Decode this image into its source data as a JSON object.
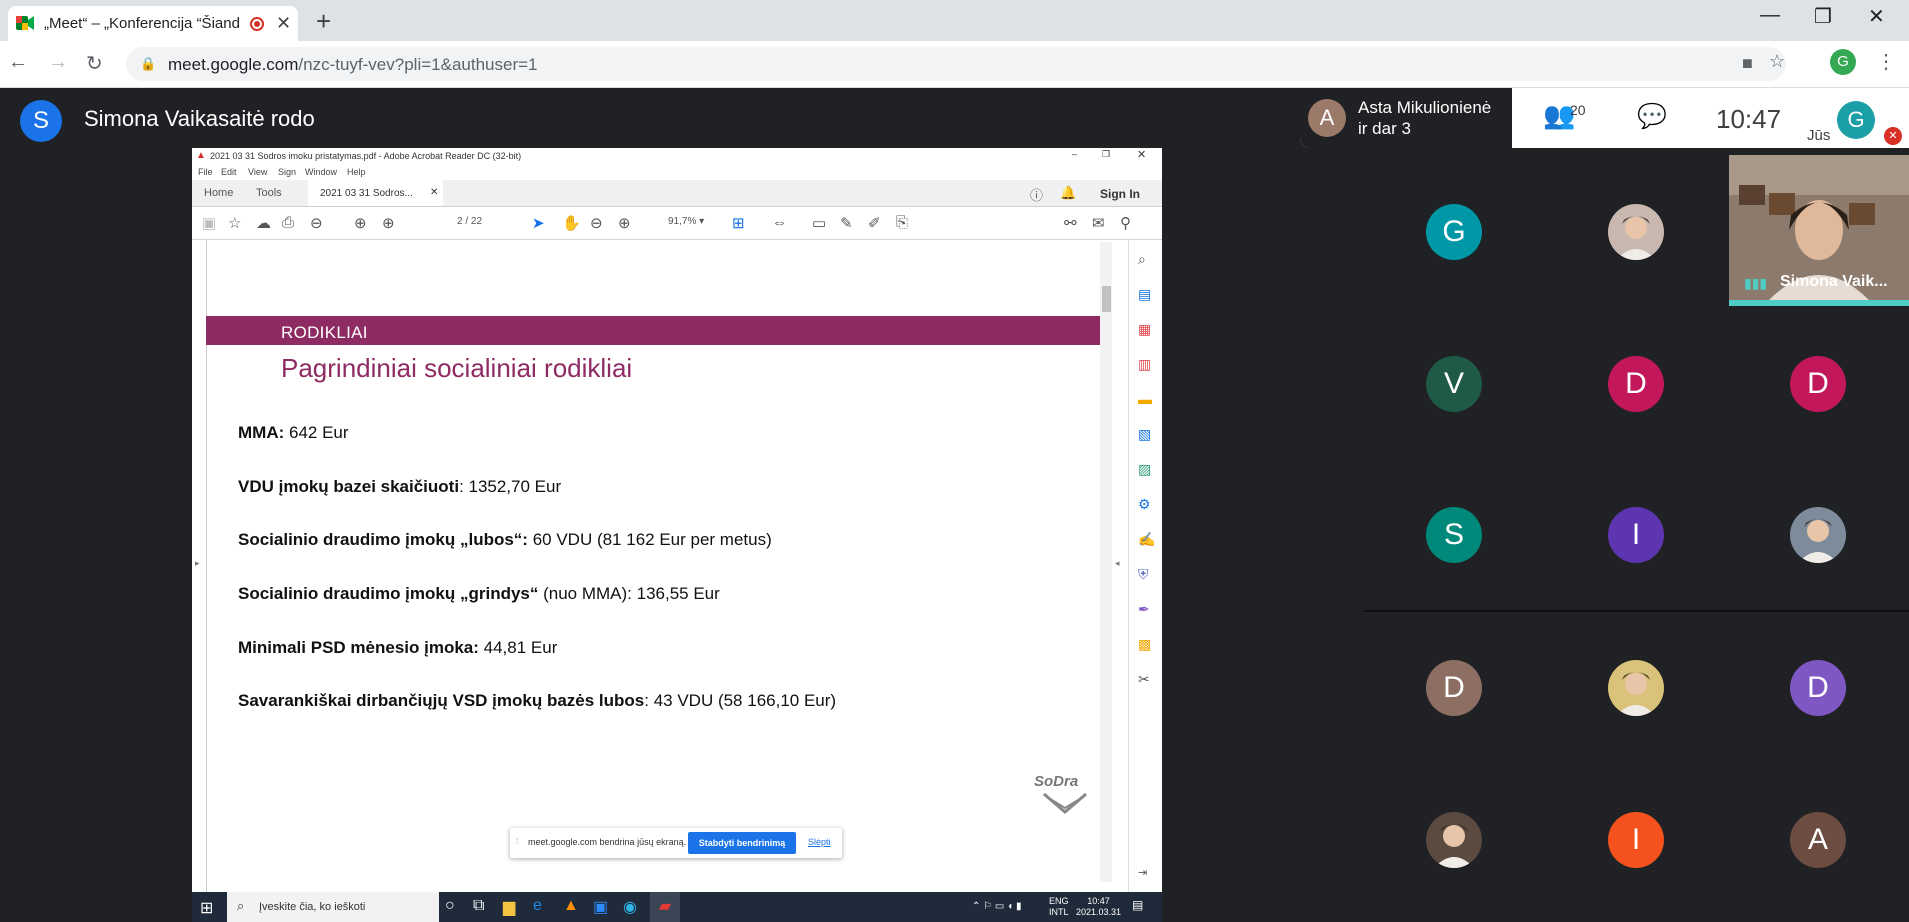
{
  "browser": {
    "tab_title": "„Meet“ – „Konferencija “Šiand",
    "url_host": "meet.google.com",
    "url_path": "/nzc-tuyf-vev?pli=1&authuser=1",
    "profile_letter": "G"
  },
  "meet": {
    "presenter_initial": "S",
    "presenter_label": "Simona Vaikasaitė rodo",
    "speaker_initial": "A",
    "speaker_name_line1": "Asta Mikulionienė",
    "speaker_name_line2": "ir dar 3",
    "participant_count": "20",
    "time": "10:47",
    "self_initial": "G",
    "self_label": "Jūs",
    "self_view_name": "Simona Vaik..."
  },
  "acrobat": {
    "window_title": "2021 03 31 Sodros  imoku pristatymas.pdf - Adobe Acrobat Reader DC (32-bit)",
    "menu": [
      "File",
      "Edit",
      "View",
      "Sign",
      "Window",
      "Help"
    ],
    "tab_home": "Home",
    "tab_tools": "Tools",
    "tab_doc": "2021 03 31 Sodros...",
    "sign_in": "Sign In",
    "page_current": "2",
    "page_total": "/ 22",
    "zoom": "91,7%"
  },
  "slide": {
    "banner": "RODIKLIAI",
    "title": "Pagrindiniai socialiniai rodikliai",
    "lines": [
      {
        "bold": "MMA:",
        "rest": " 642 Eur"
      },
      {
        "bold": "VDU įmokų bazei skaičiuoti",
        "rest": ": 1352,70 Eur"
      },
      {
        "bold": "Socialinio draudimo įmokų „lubos“:",
        "rest": " 60 VDU (81 162 Eur per metus)"
      },
      {
        "bold": "Socialinio draudimo įmokų „grindys“",
        "rest": " (nuo MMA): 136,55 Eur"
      },
      {
        "bold": "Minimali PSD mėnesio įmoka:",
        "rest": " 44,81 Eur"
      },
      {
        "bold": "Savarankiškai dirbančiųjų VSD įmokų bazės lubos",
        "rest": ": 43 VDU (58 166,10 Eur)"
      }
    ],
    "logo": "SoDra"
  },
  "share_bar": {
    "text": "meet.google.com bendrina jūsų ekraną.",
    "stop": "Stabdyti bendrinimą",
    "hide": "Slėpti"
  },
  "taskbar": {
    "search_placeholder": "Įveskite čia, ko ieškoti",
    "lang": "ENG",
    "lang2": "INTL",
    "time": "10:47",
    "date": "2021.03.31"
  },
  "participants": [
    {
      "initial": "G",
      "color": "#0097a7"
    },
    {
      "initial": "",
      "color": "#c8b8b0",
      "photo": true
    },
    {
      "initial": "V",
      "color": "#1e5a45"
    },
    {
      "initial": "D",
      "color": "#c2185b"
    },
    {
      "initial": "D",
      "color": "#c2185b"
    },
    {
      "initial": "S",
      "color": "#00897b"
    },
    {
      "initial": "I",
      "color": "#5e35b1"
    },
    {
      "initial": "",
      "color": "#7d8b9a",
      "photo": true
    },
    {
      "initial": "D",
      "color": "#8d6e63"
    },
    {
      "initial": "",
      "color": "#d9c27a",
      "photo": true
    },
    {
      "initial": "D",
      "color": "#7e57c2"
    },
    {
      "initial": "",
      "color": "#5a4a40",
      "photo": true
    },
    {
      "initial": "I",
      "color": "#f4511e"
    },
    {
      "initial": "A",
      "color": "#6d4c41"
    }
  ]
}
